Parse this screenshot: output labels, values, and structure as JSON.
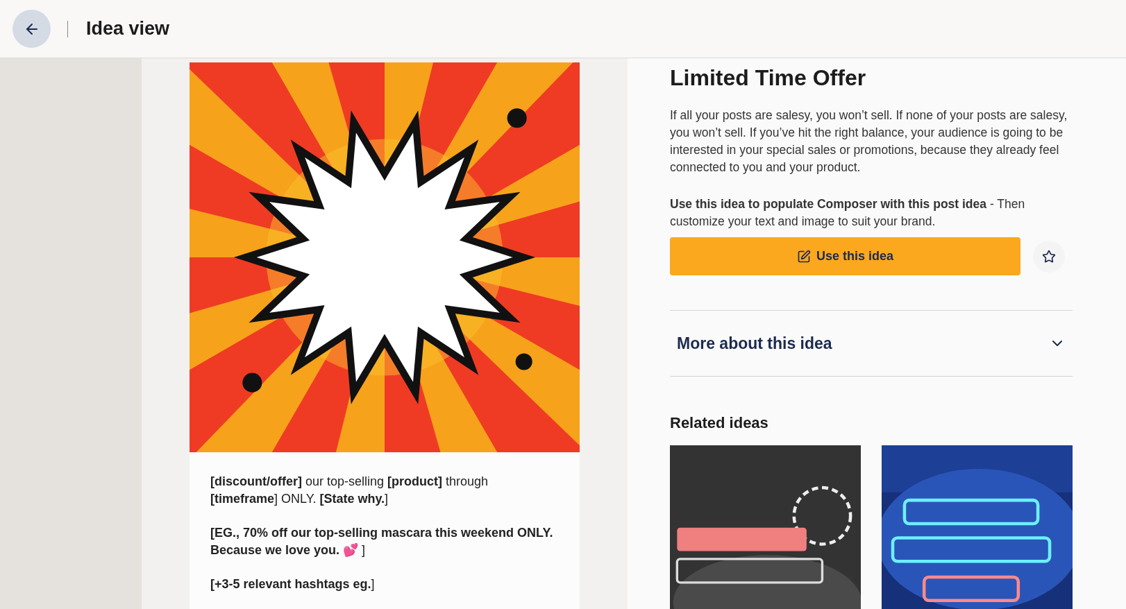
{
  "header": {
    "title": "Idea view"
  },
  "post": {
    "paragraphs": [
      "**[discount/offer]** our top-selling **[product]** through **[timeframe**] ONLY. **[State why.**]",
      "**[EG., 70% off our top-selling mascara this weekend ONLY. Because we love you.** 💕 ]",
      "**[+3-5 relevant hashtags eg.**]"
    ]
  },
  "idea": {
    "title": "Limited Time Offer",
    "description": "If all your posts are salesy, you won’t sell. If none of your posts are salesy, you won’t sell. If you’ve hit the right balance, your audience is going to be interested in your special sales or promotions, because they already feel connected to you and your product.",
    "instruction": "**Use this idea to populate Composer with this post idea** - Then customize your text and image to suit your brand.",
    "button": "Use this idea",
    "starred": false
  },
  "accordion": {
    "label": "More about this idea",
    "expanded": false
  },
  "related": {
    "title": "Related ideas",
    "items": [
      {
        "kind": "dark"
      },
      {
        "kind": "neon"
      }
    ]
  }
}
